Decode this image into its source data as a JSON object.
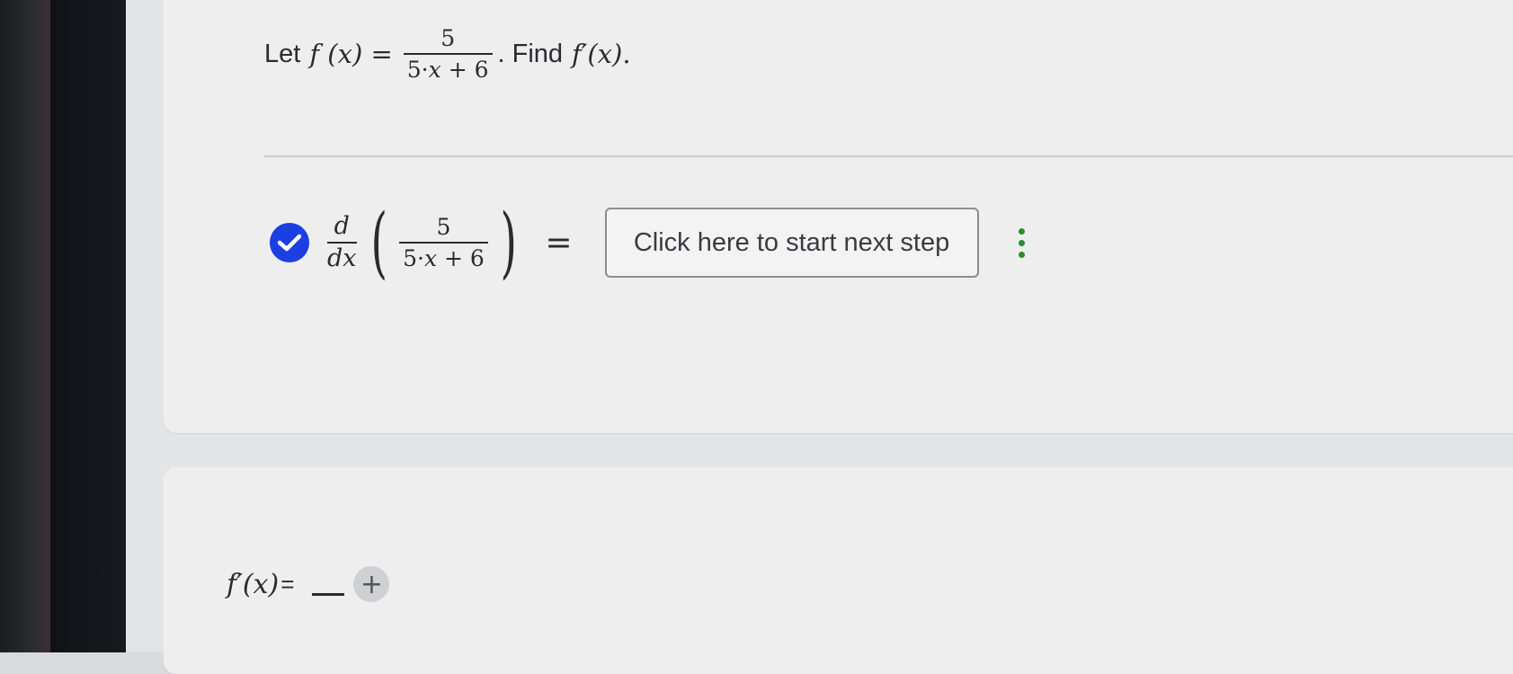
{
  "problem": {
    "prefix": "Let",
    "f_lhs": "f (x) =",
    "numerator": "5",
    "denominator_left": "5·",
    "denominator_var": "x",
    "denominator_right": " + 6",
    "suffix_text": ". Find",
    "derivative_notation": "f′(x)",
    "suffix_period": "."
  },
  "step": {
    "status_icon": "check-circle-icon",
    "d_top": "d",
    "d_bottom": "dx",
    "numerator": "5",
    "denominator_left": "5·",
    "denominator_var": "x",
    "denominator_right": " + 6",
    "equals": "=",
    "next_step_label": "Click here to start next step",
    "more_icon": "vertical-ellipsis-icon"
  },
  "answer": {
    "label": "f′(x)",
    "equals": "=",
    "add_icon_glyph": "+"
  },
  "colors": {
    "check": "#1b3fe0",
    "ellipsis": "#2e8b2c",
    "card": "#eeeeef"
  }
}
